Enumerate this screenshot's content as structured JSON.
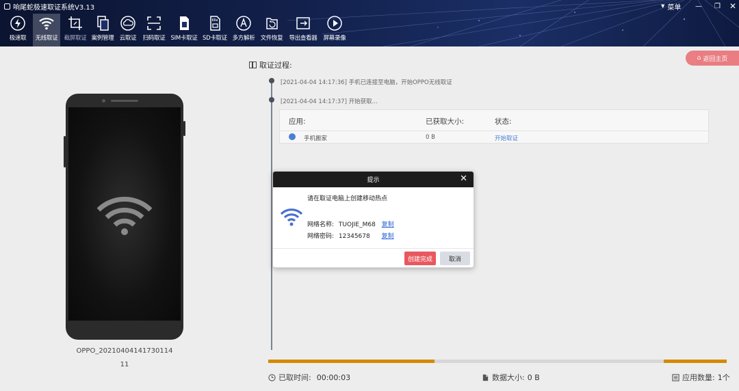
{
  "app": {
    "title": "响尾蛇极速取证系统V3.13",
    "menu_label": "菜单"
  },
  "toolbar": [
    {
      "label": "极速取",
      "icon": "lightning-icon"
    },
    {
      "label": "无线取证",
      "icon": "wifi-icon",
      "active": true
    },
    {
      "label": "截屏取证",
      "icon": "crop-icon",
      "dim": true
    },
    {
      "label": "案例管理",
      "icon": "document-copy-icon"
    },
    {
      "label": "云取证",
      "icon": "cloud-icon"
    },
    {
      "label": "扫码取证",
      "icon": "scan-icon"
    },
    {
      "label": "SIM卡取证",
      "icon": "sim-card-icon"
    },
    {
      "label": "SD卡取证",
      "icon": "sd-card-icon"
    },
    {
      "label": "多方解析",
      "icon": "compass-icon"
    },
    {
      "label": "文件恢复",
      "icon": "file-restore-icon"
    },
    {
      "label": "导出查看器",
      "icon": "export-icon"
    },
    {
      "label": "屏幕录像",
      "icon": "play-icon"
    }
  ],
  "main": {
    "back_home_label": "返回主页",
    "device_name": "OPPO_20210404141730114",
    "device_sub": "11",
    "process_title": "取证过程:",
    "logs": [
      "[2021-04-04 14:17:36] 手机已连接至电脑，开始OPPO无线取证",
      "[2021-04-04 14:17:37] 开始获取..."
    ],
    "table": {
      "headers": [
        "应用:",
        "已获取大小:",
        "状态:"
      ],
      "rows": [
        {
          "app": "手机搬家",
          "size": "0 B",
          "status": "开始取证"
        }
      ]
    },
    "status": {
      "elapsed_label": "已取时间:",
      "elapsed_value": "00:00:03",
      "data_size_label": "数据大小:",
      "data_size_value": "0 B",
      "app_count_label": "应用数量:",
      "app_count_value": "1个"
    },
    "colors": {
      "accent_red": "#e8585f",
      "progress_orange": "#d48a00",
      "link_blue": "#2a64d4"
    }
  },
  "dialog": {
    "title": "提示",
    "message": "请在取证电脑上创建移动热点",
    "network_name_label": "网络名称:",
    "network_name_value": "TUOJIE_M68",
    "password_label": "网络密码:",
    "password_value": "12345678",
    "copy_label": "复制",
    "confirm_label": "创建完成",
    "cancel_label": "取消"
  }
}
